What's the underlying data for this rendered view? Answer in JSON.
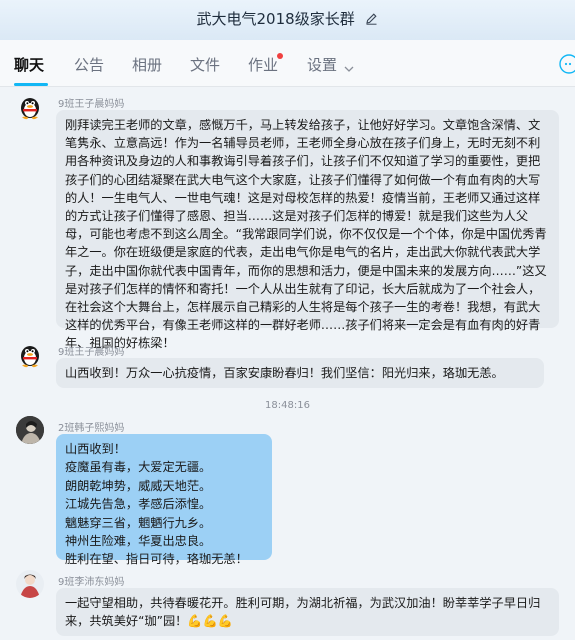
{
  "window": {
    "title": "武大电气2018级家长群"
  },
  "tabs": [
    {
      "label": "聊天"
    },
    {
      "label": "公告"
    },
    {
      "label": "相册"
    },
    {
      "label": "文件"
    },
    {
      "label": "作业"
    },
    {
      "label": "设置"
    }
  ],
  "messages": [
    {
      "sender": "9班王子晨妈妈",
      "text": "刚拜读完王老师的文章，感慨万千，马上转发给孩子，让他好好学习。文章饱含深情、文笔隽永、立意高远！作为一名辅导员老师，王老师全身心放在孩子们身上，无时无刻不利用各种资讯及身边的人和事教诲引导着孩子们，让孩子们不仅知道了学习的重要性，更把孩子们的心团结凝聚在武大电气这个大家庭，让孩子们懂得了如何做一个有血有肉的大写的人！一生电气人、一世电气魂！这是对母校怎样的热爱！疫情当前，王老师又通过这样的方式让孩子们懂得了感恩、担当……这是对孩子们怎样的博爱！就是我们这些为人父母，可能也考虑不到这么周全。“我常跟同学们说，你不仅仅是一个个体，你是中国优秀青年之一。你在班级便是家庭的代表，走出电气你是电气的名片，走出武大你就代表武大学子，走出中国你就代表中国青年，而你的思想和活力，便是中国未来的发展方向……”这又是对孩子们怎样的情怀和寄托！一个人从出生就有了印记，长大后就成为了一个社会人，在社会这个大舞台上，怎样展示自己精彩的人生将是每个孩子一生的考卷！我想，有武大这样的优秀平台，有像王老师这样的一群好老师……孩子们将来一定会是有血有肉的好青年、祖国的好栋梁！"
    },
    {
      "sender": "9班王子晨妈妈",
      "text": "山西收到！万众一心抗疫情，百家安康盼春归！我们坚信：阳光归来，珞珈无恙。"
    },
    {
      "timestamp": "18:48:16",
      "sender": "2班韩子熙妈妈",
      "lines": [
        "山西收到！",
        "疫魔虽有毒，大爱定无疆。",
        "朗朗乾坤势，威威天地茫。",
        "江城先告急，孝感后添惶。",
        "魑魅穿三省，魍魉行九乡。",
        "神州生险难，华夏出忠良。",
        "胜利在望、指日可待，珞珈无恙！"
      ]
    },
    {
      "sender": "9班李沛东妈妈",
      "text": "一起守望相助，共待春暖花开。胜利可期，为湖北祈福，为武汉加油！盼莘莘学子早日归来，共筑美好“珈”园！💪💪💪"
    }
  ],
  "colors": {
    "accent": "#12b7f5",
    "bubble_gray": "#e4e9ee",
    "bubble_blue": "#9cd0f5",
    "notification_dot": "#f04040"
  },
  "icons": [
    "edit-icon",
    "chevron-down-icon",
    "qq-penguin-avatar",
    "more-icon"
  ]
}
